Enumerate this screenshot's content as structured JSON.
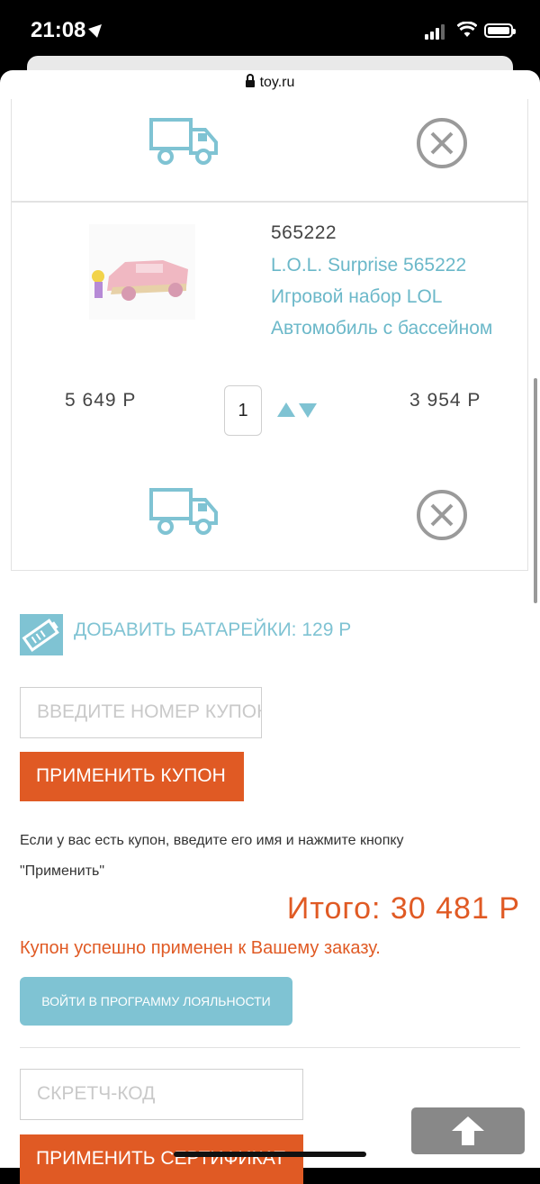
{
  "status_bar": {
    "time": "21:08"
  },
  "browser": {
    "url": "toy.ru"
  },
  "product": {
    "sku": "565222",
    "name_lines": [
      "L.O.L. Surprise 565222",
      "Игровой набор LOL",
      "Автомобиль с бассейном"
    ],
    "old_price": "5 649 Р",
    "quantity": "1",
    "price": "3 954 Р"
  },
  "extras": {
    "add_batteries": "ДОБАВИТЬ БАТАРЕЙКИ: 129 Р"
  },
  "coupon": {
    "placeholder": "ВВЕДИТЕ НОМЕР КУПОНА",
    "apply_label": "ПРИМЕНИТЬ КУПОН",
    "hint_line1": "Если у вас есть купон, введите его имя и нажмите кнопку",
    "hint_line2": "\"Применить\"",
    "success": "Купон успешно применен к Вашему заказу."
  },
  "summary": {
    "total": "Итого: 30 481 Р"
  },
  "loyalty": {
    "label": "ВОЙТИ В ПРОГРАММУ ЛОЯЛЬНОСТИ"
  },
  "certificate": {
    "placeholder": "СКРЕТЧ-КОД",
    "apply_label": "ПРИМЕНИТЬ СЕРТИФИКАТ"
  },
  "colors": {
    "accent_orange": "#e05a24",
    "accent_teal": "#7fc3d3"
  },
  "icons": [
    "truck-icon",
    "remove-icon",
    "battery-pack-icon",
    "arrow-up-icon"
  ]
}
